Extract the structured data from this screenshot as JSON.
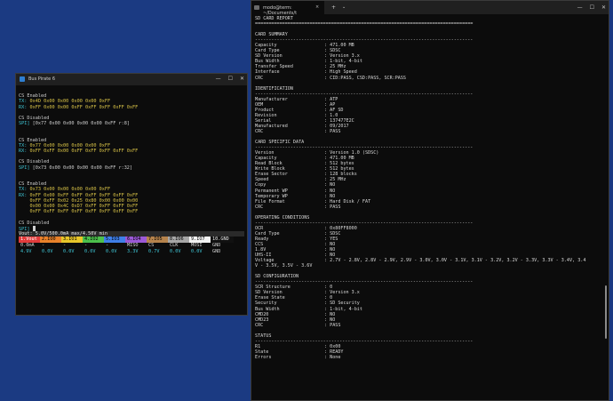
{
  "left_window": {
    "title": "Bus Pirate 6",
    "terminal_lines": [
      {
        "segs": [
          {
            "t": ""
          }
        ]
      },
      {
        "segs": [
          {
            "t": "CS Enabled"
          }
        ]
      },
      {
        "segs": [
          {
            "t": "TX: ",
            "c": "cy"
          },
          {
            "t": "0x4D 0x00 0x00 0x00 0x00 0xFF",
            "c": "yl"
          }
        ]
      },
      {
        "segs": [
          {
            "t": "RX: ",
            "c": "cy"
          },
          {
            "t": "0xFF 0x00 0x00 0xFF 0xFF 0xFF 0xFF 0xFF",
            "c": "yl"
          }
        ]
      },
      {
        "segs": [
          {
            "t": ""
          }
        ]
      },
      {
        "segs": [
          {
            "t": "CS Disabled"
          }
        ]
      },
      {
        "segs": [
          {
            "t": "SPI] ",
            "c": "cy"
          },
          {
            "t": "[0x77 0x00 0x00 0x00 0x00 0xFF r:8]"
          }
        ]
      },
      {
        "segs": [
          {
            "t": ""
          }
        ]
      },
      {
        "segs": [
          {
            "t": ""
          }
        ]
      },
      {
        "segs": [
          {
            "t": "CS Enabled"
          }
        ]
      },
      {
        "segs": [
          {
            "t": "TX: ",
            "c": "cy"
          },
          {
            "t": "0x77 0x00 0x00 0x00 0x00 0xFF",
            "c": "yl"
          }
        ]
      },
      {
        "segs": [
          {
            "t": "RX: ",
            "c": "cy"
          },
          {
            "t": "0xFF 0xFF 0x00 0xFF 0xFF 0xFF 0xFF 0xFF",
            "c": "yl"
          }
        ]
      },
      {
        "segs": [
          {
            "t": ""
          }
        ]
      },
      {
        "segs": [
          {
            "t": "CS Disabled"
          }
        ]
      },
      {
        "segs": [
          {
            "t": "SPI] ",
            "c": "cy"
          },
          {
            "t": "[0x73 0x00 0x00 0x00 0x00 0xFF r:32]"
          }
        ]
      },
      {
        "segs": [
          {
            "t": ""
          }
        ]
      },
      {
        "segs": [
          {
            "t": ""
          }
        ]
      },
      {
        "segs": [
          {
            "t": "CS Enabled"
          }
        ]
      },
      {
        "segs": [
          {
            "t": "TX: ",
            "c": "cy"
          },
          {
            "t": "0x73 0x00 0x00 0x00 0x00 0xFF",
            "c": "yl"
          }
        ]
      },
      {
        "segs": [
          {
            "t": "RX: ",
            "c": "cy"
          },
          {
            "t": "0xFF 0x00 0xFF 0xFF 0xFF 0xFF 0xFF 0xFF",
            "c": "yl"
          }
        ]
      },
      {
        "segs": [
          {
            "t": "    "
          },
          {
            "t": "0xFF 0xFF 0x02 0x25 0x80 0x00 0x00 0x00",
            "c": "yl"
          }
        ]
      },
      {
        "segs": [
          {
            "t": "    "
          },
          {
            "t": "0x00 0x00 0x4C 0xD7 0xFF 0xFF 0xFF 0xFF",
            "c": "yl"
          }
        ]
      },
      {
        "segs": [
          {
            "t": "    "
          },
          {
            "t": "0xFF 0xFF 0xFF 0xFF 0xFF 0xFF 0xFF 0xFF",
            "c": "yl"
          }
        ]
      },
      {
        "segs": [
          {
            "t": ""
          }
        ]
      },
      {
        "segs": [
          {
            "t": "CS Disabled"
          }
        ]
      },
      {
        "segs": [
          {
            "t": "SPI] ",
            "c": "cy"
          }
        ],
        "cursor": true
      }
    ],
    "vout_line": "Vout: 5.0V/500.0mA max/4.50V min",
    "pins": [
      {
        "label": "1.Vout",
        "color": "#e23b3b"
      },
      {
        "label": "2.IO0",
        "color": "#e8812a"
      },
      {
        "label": "3.IO1",
        "color": "#e8c62a"
      },
      {
        "label": "4.IO2",
        "color": "#4cc04c"
      },
      {
        "label": "5.IO3",
        "color": "#3f7fe8"
      },
      {
        "label": "6.IO4",
        "color": "#9b59d6"
      },
      {
        "label": "7.IO5",
        "color": "#b5834c"
      },
      {
        "label": "8.IO6",
        "color": "#a6a6a6"
      },
      {
        "label": "9.IO7",
        "color": "#f2f2f2"
      },
      {
        "label": "10.GND",
        "color": "#111111"
      }
    ],
    "pin_functions": [
      "0.0mA",
      "-",
      "-",
      "-",
      "-",
      "MISO",
      "CS",
      "CLK",
      "MOSI",
      "GND"
    ],
    "pin_voltages": [
      "4.9V",
      "0.0V",
      "0.0V",
      "0.0V",
      "0.0V",
      "3.3V",
      "0.7V",
      "0.0V",
      "0.0V",
      "GND"
    ]
  },
  "right_window": {
    "tab_title": "modo@term: ~/Documents/t",
    "tab_close": "×",
    "new_tab": "+",
    "dropdown": "⌄",
    "controls": [
      "—",
      "☐",
      "✕"
    ],
    "report_lines": [
      {
        "t": "SD CARD REPORT"
      },
      {
        "t": "================================================================================"
      },
      {
        "t": ""
      },
      {
        "t": "CARD SUMMARY"
      },
      {
        "t": "--------------------------------------------------------------------------------"
      },
      {
        "k": "Capacity",
        "v": ": 471.00 MB"
      },
      {
        "k": "Card Type",
        "v": ": SDSC"
      },
      {
        "k": "SD Version",
        "v": ": Version 3.x"
      },
      {
        "k": "Bus Width",
        "v": ": 1-bit, 4-bit"
      },
      {
        "k": "Transfer Speed",
        "v": ": 25 MHz"
      },
      {
        "k": "Interface",
        "v": ": High Speed"
      },
      {
        "k": "CRC",
        "v": ": CID:PASS, CSD:PASS, SCR:PASS"
      },
      {
        "t": ""
      },
      {
        "t": "IDENTIFICATION"
      },
      {
        "t": "--------------------------------------------------------------------------------"
      },
      {
        "k": "Manufacturer",
        "v": ": ATP"
      },
      {
        "k": "OEM",
        "v": ": AP"
      },
      {
        "k": "Product",
        "v": ": AF SD"
      },
      {
        "k": "Revision",
        "v": ": 1.0"
      },
      {
        "k": "Serial",
        "v": ": 137477E2C"
      },
      {
        "k": "Manufactured",
        "v": ": 09/2017"
      },
      {
        "k": "CRC",
        "v": ": PASS"
      },
      {
        "t": ""
      },
      {
        "t": "CARD SPECIFIC DATA"
      },
      {
        "t": "--------------------------------------------------------------------------------"
      },
      {
        "k": "Version",
        "v": ": Version 1.0 (SDSC)"
      },
      {
        "k": "Capacity",
        "v": ": 471.00 MB"
      },
      {
        "k": "Read Block",
        "v": ": 512 bytes"
      },
      {
        "k": "Write Block",
        "v": ": 512 bytes"
      },
      {
        "k": "Erase Sector",
        "v": ": 128 blocks"
      },
      {
        "k": "Speed",
        "v": ": 25 MHz"
      },
      {
        "k": "Copy",
        "v": ": NO"
      },
      {
        "k": "Permanent WP",
        "v": ": NO"
      },
      {
        "k": "Temporary WP",
        "v": ": NO"
      },
      {
        "k": "File Format",
        "v": ": Hard Disk / FAT"
      },
      {
        "k": "CRC",
        "v": ": PASS"
      },
      {
        "t": ""
      },
      {
        "t": "OPERATING CONDITIONS"
      },
      {
        "t": "--------------------------------------------------------------------------------"
      },
      {
        "k": "OCR",
        "v": ": 0x80FF8000"
      },
      {
        "k": "Card Type",
        "v": ": SDSC"
      },
      {
        "k": "Ready",
        "v": ": YES"
      },
      {
        "k": "CCS",
        "v": ": NO"
      },
      {
        "k": "1.8V",
        "v": ": NO"
      },
      {
        "k": "UHS-II",
        "v": ": NO"
      },
      {
        "k": "Voltage",
        "v": ": 2.7V - 2.8V, 2.8V - 2.9V, 2.9V - 3.0V, 3.0V - 3.1V, 3.1V - 3.2V, 3.2V - 3.3V, 3.3V - 3.4V, 3.4"
      },
      {
        "t": "V - 3.5V, 3.5V - 3.6V"
      },
      {
        "t": ""
      },
      {
        "t": "SD CONFIGURATION"
      },
      {
        "t": "--------------------------------------------------------------------------------"
      },
      {
        "k": "SCR Structure",
        "v": ": 0"
      },
      {
        "k": "SD Version",
        "v": ": Version 3.x"
      },
      {
        "k": "Erase State",
        "v": ": 0"
      },
      {
        "k": "Security",
        "v": ": SD Security"
      },
      {
        "k": "Bus Width",
        "v": ": 1-bit, 4-bit"
      },
      {
        "k": "CMD20",
        "v": ": NO"
      },
      {
        "k": "CMD23",
        "v": ": NO"
      },
      {
        "k": "CRC",
        "v": ": PASS"
      },
      {
        "t": ""
      },
      {
        "t": "STATUS"
      },
      {
        "t": "--------------------------------------------------------------------------------"
      },
      {
        "k": "R1",
        "v": ": 0x00"
      },
      {
        "k": "State",
        "v": ": READY"
      },
      {
        "k": "Errors",
        "v": ": None"
      }
    ]
  }
}
